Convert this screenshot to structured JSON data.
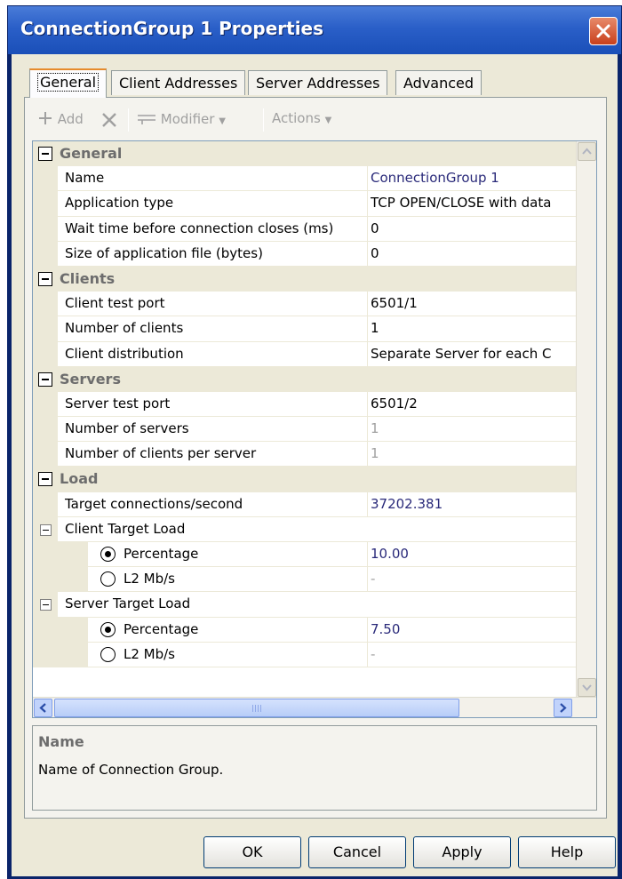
{
  "window": {
    "title": "ConnectionGroup 1 Properties"
  },
  "tabs": [
    {
      "label": "General"
    },
    {
      "label": "Client Addresses"
    },
    {
      "label": "Server Addresses"
    },
    {
      "label": "Advanced"
    }
  ],
  "toolbar": {
    "add": "Add",
    "modifier": "Modifier",
    "actions": "Actions"
  },
  "grid": {
    "general": {
      "heading": "General",
      "name_label": "Name",
      "name_value": "ConnectionGroup 1",
      "apptype_label": "Application type",
      "apptype_value": "TCP OPEN/CLOSE with data",
      "wait_label": "Wait time before connection closes (ms)",
      "wait_value": "0",
      "size_label": "Size of application file (bytes)",
      "size_value": "0"
    },
    "clients": {
      "heading": "Clients",
      "port_label": "Client test port",
      "port_value": "6501/1",
      "num_label": "Number of clients",
      "num_value": "1",
      "dist_label": "Client distribution",
      "dist_value": "Separate Server for each C"
    },
    "servers": {
      "heading": "Servers",
      "port_label": "Server test port",
      "port_value": "6501/2",
      "num_label": "Number of servers",
      "num_value": "1",
      "per_label": "Number of clients per server",
      "per_value": "1"
    },
    "load": {
      "heading": "Load",
      "target_label": "Target connections/second",
      "target_value": "37202.381",
      "client_group": "Client Target Load",
      "client_pct_label": "Percentage",
      "client_pct_value": "10.00",
      "client_l2_label": "L2 Mb/s",
      "client_l2_value": "-",
      "server_group": "Server Target Load",
      "server_pct_label": "Percentage",
      "server_pct_value": "7.50",
      "server_l2_label": "L2 Mb/s",
      "server_l2_value": "-"
    }
  },
  "description": {
    "title": "Name",
    "text": "Name of Connection Group."
  },
  "buttons": {
    "ok": "OK",
    "cancel": "Cancel",
    "apply": "Apply",
    "help": "Help"
  }
}
